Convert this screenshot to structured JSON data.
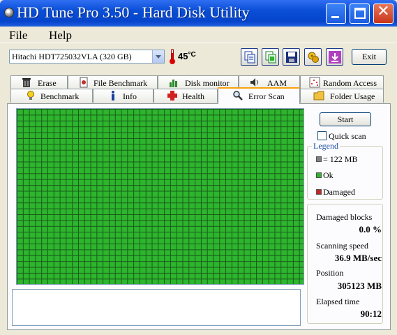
{
  "window": {
    "title": "HD Tune Pro 3.50 - Hard Disk Utility",
    "titlebar_color": "#0a4fd6"
  },
  "menu": {
    "file": "File",
    "help": "Help"
  },
  "toolbar": {
    "drive": "Hitachi HDT725032VLA (320 GB)",
    "temperature": "45",
    "exit_label": "Exit",
    "icons": [
      "copy-text-icon",
      "copy-screenshot-icon",
      "save-icon",
      "options-icon",
      "download-icon"
    ]
  },
  "tabs": {
    "row1": [
      "Erase",
      "File Benchmark",
      "Disk monitor",
      "AAM",
      "Random Access"
    ],
    "row2": [
      "Benchmark",
      "Info",
      "Health",
      "Error Scan",
      "Folder Usage"
    ],
    "active": "Error Scan"
  },
  "scan": {
    "start_label": "Start",
    "quick_scan_label": "Quick scan",
    "quick_scan_checked": false,
    "block_ok_color": "#2db52d"
  },
  "legend": {
    "title": "Legend",
    "block_size": "= 122 MB",
    "ok": "Ok",
    "damaged": "Damaged",
    "block_color": "#808080",
    "ok_color": "#2db52d",
    "damaged_color": "#cc2222"
  },
  "stats": {
    "damaged_blocks_label": "Damaged blocks",
    "damaged_blocks_value": "0.0 %",
    "scanning_speed_label": "Scanning speed",
    "scanning_speed_value": "36.9 MB/sec",
    "position_label": "Position",
    "position_value": "305123 MB",
    "elapsed_label": "Elapsed time",
    "elapsed_value": "90:12"
  }
}
